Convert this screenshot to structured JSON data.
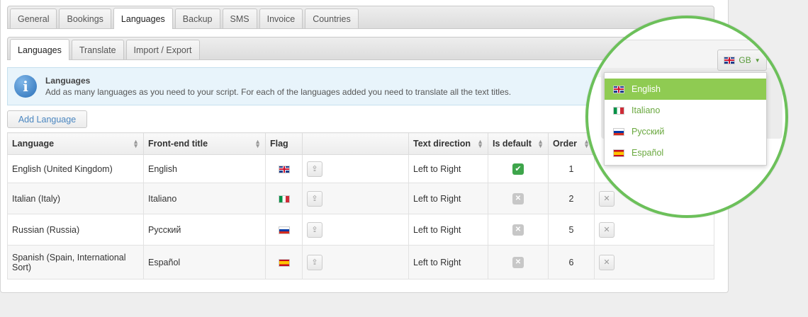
{
  "main_tabs": [
    "General",
    "Bookings",
    "Languages",
    "Backup",
    "SMS",
    "Invoice",
    "Countries"
  ],
  "sub_tabs": [
    "Languages",
    "Translate",
    "Import / Export"
  ],
  "info": {
    "title": "Languages",
    "text": "Add as many languages as you need to your script. For each of the languages added you need to translate all the text titles."
  },
  "add_button": "Add Language",
  "table": {
    "headers": [
      "Language",
      "Front-end title",
      "Flag",
      "",
      "Text direction",
      "Is default",
      "Order"
    ],
    "rows": [
      {
        "language": "English (United Kingdom)",
        "title": "English",
        "flag": "gb",
        "direction": "Left to Right",
        "is_default": true,
        "order": "1"
      },
      {
        "language": "Italian (Italy)",
        "title": "Italiano",
        "flag": "it",
        "direction": "Left to Right",
        "is_default": false,
        "order": "2"
      },
      {
        "language": "Russian (Russia)",
        "title": "Русский",
        "flag": "ru",
        "direction": "Left to Right",
        "is_default": false,
        "order": "5"
      },
      {
        "language": "Spanish (Spain, International Sort)",
        "title": "Español",
        "flag": "es",
        "direction": "Left to Right",
        "is_default": false,
        "order": "6"
      }
    ]
  },
  "zoom": {
    "switch_label": "GB",
    "dropdown": [
      {
        "label": "English",
        "flag": "gb",
        "selected": true
      },
      {
        "label": "Italiano",
        "flag": "it",
        "selected": false
      },
      {
        "label": "Русский",
        "flag": "ru",
        "selected": false
      },
      {
        "label": "Español",
        "flag": "es",
        "selected": false
      }
    ]
  },
  "colors": {
    "accent_green": "#8fcb52",
    "circle_border": "#6cc05a",
    "link_blue": "#4a86c0"
  }
}
